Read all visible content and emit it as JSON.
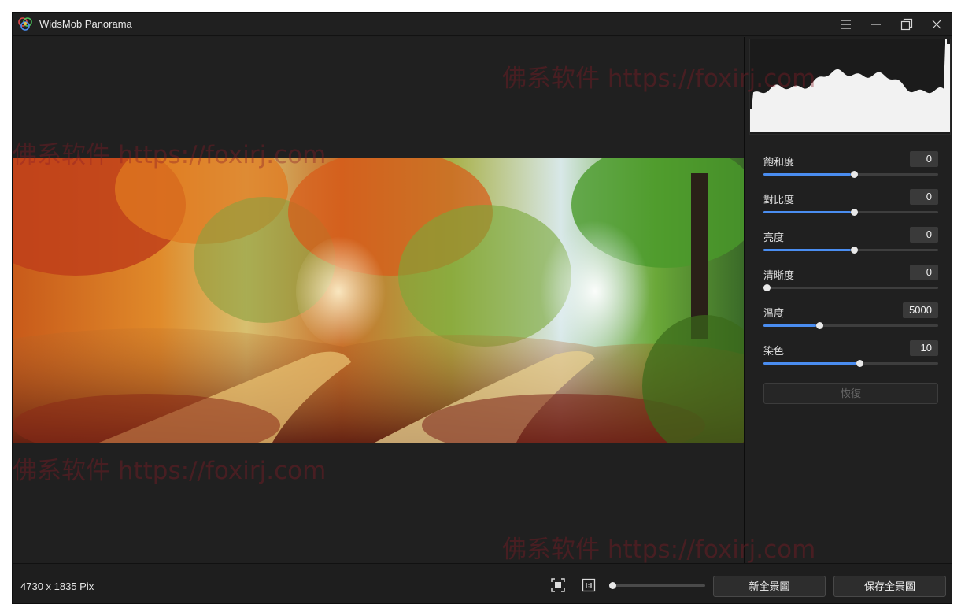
{
  "window": {
    "title": "WidsMob Panorama"
  },
  "titlebar": {
    "buttons": [
      {
        "name": "menu-icon"
      },
      {
        "name": "minimize-icon"
      },
      {
        "name": "restore-icon"
      },
      {
        "name": "close-icon"
      }
    ]
  },
  "adjustments": [
    {
      "label": "飽和度",
      "value": "0",
      "level": 0.5
    },
    {
      "label": "對比度",
      "value": "0",
      "level": 0.5
    },
    {
      "label": "亮度",
      "value": "0",
      "level": 0.5
    },
    {
      "label": "清晰度",
      "value": "0",
      "level": 0.0
    },
    {
      "label": "溫度",
      "value": "5000",
      "level": 0.3
    },
    {
      "label": "染色",
      "value": "10",
      "level": 0.53
    }
  ],
  "panel": {
    "reset_label": "恢復"
  },
  "status": {
    "dimensions": "4730 x 1835 Pix",
    "zoom_level": 0.0
  },
  "bottombar": {
    "new_label": "新全景圖",
    "save_label": "保存全景圖"
  },
  "watermark": {
    "text": "佛系软件 https://foxirj.com"
  },
  "colors": {
    "accent": "#4a8df0",
    "background": "#1f1f1f"
  }
}
